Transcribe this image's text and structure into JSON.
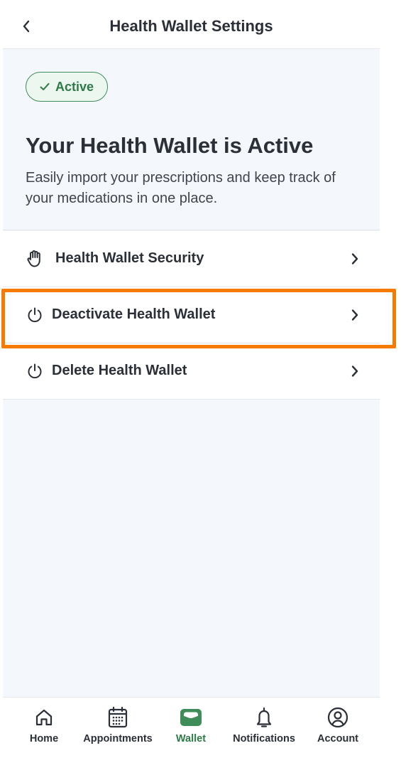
{
  "header": {
    "title": "Health Wallet Settings",
    "back_icon": "chevron-left-icon"
  },
  "hero": {
    "badge": "Active",
    "badge_icon": "check-icon",
    "title": "Your Health Wallet is Active",
    "description": "Easily import your prescriptions and keep track of your medications in one place."
  },
  "menu": {
    "items": [
      {
        "label": "Health Wallet Security",
        "icon": "hand-icon"
      },
      {
        "label": "Deactivate Health Wallet",
        "icon": "power-icon"
      },
      {
        "label": "Delete Health Wallet",
        "icon": "power-icon"
      }
    ]
  },
  "tabs": [
    {
      "label": "Home",
      "icon": "home-icon"
    },
    {
      "label": "Appointments",
      "icon": "calendar-icon"
    },
    {
      "label": "Wallet",
      "icon": "wallet-icon",
      "active": true
    },
    {
      "label": "Notifications",
      "icon": "bell-icon"
    },
    {
      "label": "Account",
      "icon": "account-icon"
    }
  ],
  "colors": {
    "accent": "#2f7a48",
    "highlight": "#f57c00",
    "background": "#f4f7fb",
    "text": "#2b2f38"
  }
}
